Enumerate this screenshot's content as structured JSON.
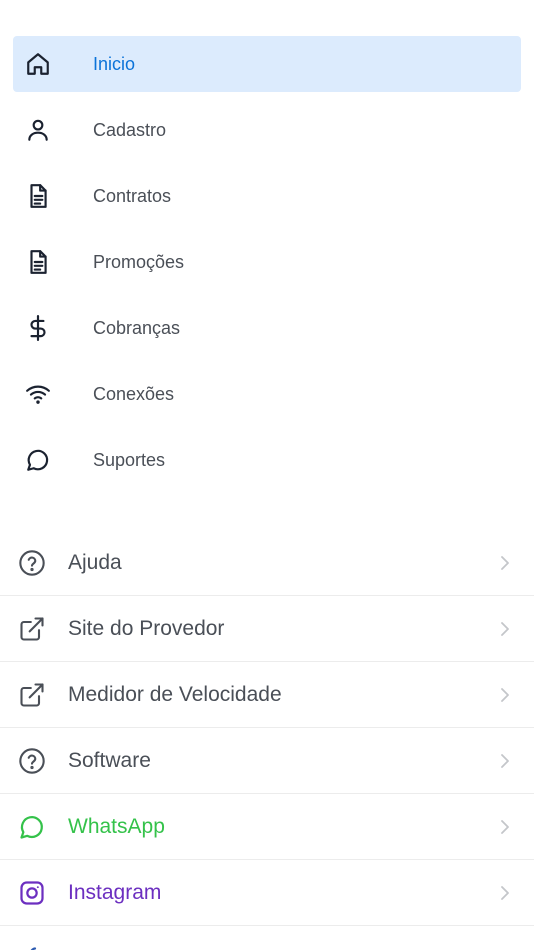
{
  "nav": {
    "items": [
      {
        "label": "Inicio",
        "icon": "home-icon",
        "active": true
      },
      {
        "label": "Cadastro",
        "icon": "user-icon"
      },
      {
        "label": "Contratos",
        "icon": "document-icon"
      },
      {
        "label": "Promoções",
        "icon": "document-icon"
      },
      {
        "label": "Cobranças",
        "icon": "dollar-icon"
      },
      {
        "label": "Conexões",
        "icon": "wifi-icon"
      },
      {
        "label": "Suportes",
        "icon": "chat-bubble-icon"
      }
    ]
  },
  "links": {
    "items": [
      {
        "label": "Ajuda",
        "icon": "help-circle-icon"
      },
      {
        "label": "Site do Provedor",
        "icon": "external-link-icon"
      },
      {
        "label": "Medidor de Velocidade",
        "icon": "external-link-icon"
      },
      {
        "label": "Software",
        "icon": "help-circle-icon"
      },
      {
        "label": "WhatsApp",
        "icon": "whatsapp-icon",
        "color": "#34c24a"
      },
      {
        "label": "Instagram",
        "icon": "instagram-icon",
        "color": "#6c2fc0"
      }
    ]
  },
  "colors": {
    "active_bg": "#dcebfd",
    "active_text": "#0b73d9",
    "text": "#4a4f57",
    "whatsapp": "#34c24a",
    "instagram": "#6c2fc0"
  }
}
